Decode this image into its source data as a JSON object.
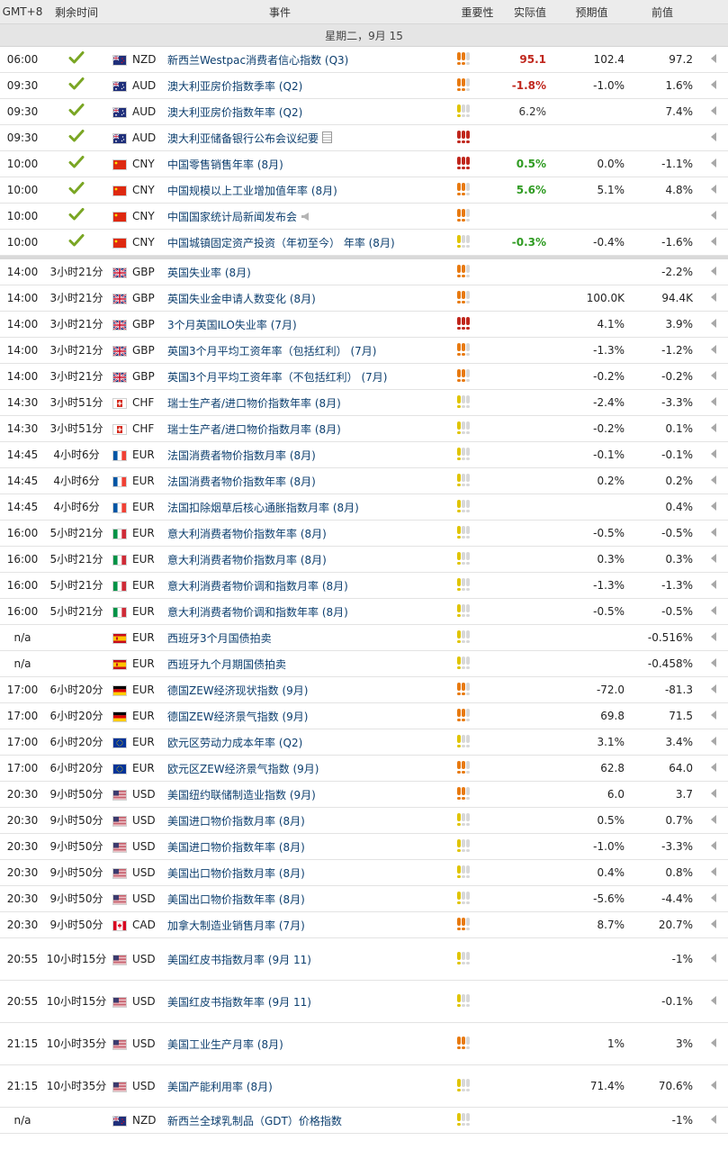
{
  "header": {
    "timezone": "GMT+8",
    "remaining": "剩余时间",
    "event": "事件",
    "importance": "重要性",
    "actual": "实际值",
    "forecast": "预期值",
    "previous": "前值"
  },
  "date_label": "星期二，9月 15",
  "colors": {
    "low": "#e0c400",
    "med": "#e87a10",
    "high": "#c0271d",
    "off": "#d8d8d8",
    "check": "#7aa624"
  },
  "events": [
    {
      "time": "06:00",
      "remaining": "",
      "done": true,
      "flag": "nz",
      "currency": "NZD",
      "name": "新西兰Westpac消费者信心指数 (Q3)",
      "imp": 2,
      "actual": "95.1",
      "dir": "down",
      "forecast": "102.4",
      "previous": "97.2",
      "icon": ""
    },
    {
      "time": "09:30",
      "remaining": "",
      "done": true,
      "flag": "au",
      "currency": "AUD",
      "name": "澳大利亚房价指数季率 (Q2)",
      "imp": 2,
      "actual": "-1.8%",
      "dir": "down",
      "forecast": "-1.0%",
      "previous": "1.6%",
      "icon": ""
    },
    {
      "time": "09:30",
      "remaining": "",
      "done": true,
      "flag": "au",
      "currency": "AUD",
      "name": "澳大利亚房价指数年率 (Q2)",
      "imp": 1,
      "actual": "6.2%",
      "dir": "neutral",
      "forecast": "",
      "previous": "7.4%",
      "icon": ""
    },
    {
      "time": "09:30",
      "remaining": "",
      "done": true,
      "flag": "au",
      "currency": "AUD",
      "name": "澳大利亚储备银行公布会议纪要",
      "imp": 3,
      "actual": "",
      "dir": "neutral",
      "forecast": "",
      "previous": "",
      "icon": "doc-icon"
    },
    {
      "time": "10:00",
      "remaining": "",
      "done": true,
      "flag": "cn",
      "currency": "CNY",
      "name": "中国零售销售年率 (8月)",
      "imp": 3,
      "actual": "0.5%",
      "dir": "up",
      "forecast": "0.0%",
      "previous": "-1.1%",
      "icon": ""
    },
    {
      "time": "10:00",
      "remaining": "",
      "done": true,
      "flag": "cn",
      "currency": "CNY",
      "name": "中国规模以上工业增加值年率 (8月)",
      "imp": 2,
      "actual": "5.6%",
      "dir": "up",
      "forecast": "5.1%",
      "previous": "4.8%",
      "icon": ""
    },
    {
      "time": "10:00",
      "remaining": "",
      "done": true,
      "flag": "cn",
      "currency": "CNY",
      "name": "中国国家统计局新闻发布会",
      "imp": 2,
      "actual": "",
      "dir": "neutral",
      "forecast": "",
      "previous": "",
      "icon": "speaker-icon"
    },
    {
      "time": "10:00",
      "remaining": "",
      "done": true,
      "flag": "cn",
      "currency": "CNY",
      "name": "中国城镇固定资产投资（年初至今） 年率 (8月)",
      "imp": 1,
      "actual": "-0.3%",
      "dir": "up",
      "forecast": "-0.4%",
      "previous": "-1.6%",
      "icon": ""
    },
    {
      "separator": true
    },
    {
      "time": "14:00",
      "remaining": "3小时21分",
      "done": false,
      "flag": "gb",
      "currency": "GBP",
      "name": "英国失业率 (8月)",
      "imp": 2,
      "actual": "",
      "dir": "neutral",
      "forecast": "",
      "previous": "-2.2%",
      "icon": ""
    },
    {
      "time": "14:00",
      "remaining": "3小时21分",
      "done": false,
      "flag": "gb",
      "currency": "GBP",
      "name": "英国失业金申请人数变化 (8月)",
      "imp": 2,
      "actual": "",
      "dir": "neutral",
      "forecast": "100.0K",
      "previous": "94.4K",
      "icon": ""
    },
    {
      "time": "14:00",
      "remaining": "3小时21分",
      "done": false,
      "flag": "gb",
      "currency": "GBP",
      "name": "3个月英国ILO失业率 (7月)",
      "imp": 3,
      "actual": "",
      "dir": "neutral",
      "forecast": "4.1%",
      "previous": "3.9%",
      "icon": ""
    },
    {
      "time": "14:00",
      "remaining": "3小时21分",
      "done": false,
      "flag": "gb",
      "currency": "GBP",
      "name": "英国3个月平均工资年率（包括红利） (7月)",
      "imp": 2,
      "actual": "",
      "dir": "neutral",
      "forecast": "-1.3%",
      "previous": "-1.2%",
      "icon": ""
    },
    {
      "time": "14:00",
      "remaining": "3小时21分",
      "done": false,
      "flag": "gb",
      "currency": "GBP",
      "name": "英国3个月平均工资年率（不包括红利） (7月)",
      "imp": 2,
      "actual": "",
      "dir": "neutral",
      "forecast": "-0.2%",
      "previous": "-0.2%",
      "icon": ""
    },
    {
      "time": "14:30",
      "remaining": "3小时51分",
      "done": false,
      "flag": "ch",
      "currency": "CHF",
      "name": "瑞士生产者/进口物价指数年率 (8月)",
      "imp": 1,
      "actual": "",
      "dir": "neutral",
      "forecast": "-2.4%",
      "previous": "-3.3%",
      "icon": ""
    },
    {
      "time": "14:30",
      "remaining": "3小时51分",
      "done": false,
      "flag": "ch",
      "currency": "CHF",
      "name": "瑞士生产者/进口物价指数月率 (8月)",
      "imp": 1,
      "actual": "",
      "dir": "neutral",
      "forecast": "-0.2%",
      "previous": "0.1%",
      "icon": ""
    },
    {
      "time": "14:45",
      "remaining": "4小时6分",
      "done": false,
      "flag": "fr",
      "currency": "EUR",
      "name": "法国消费者物价指数月率 (8月)",
      "imp": 1,
      "actual": "",
      "dir": "neutral",
      "forecast": "-0.1%",
      "previous": "-0.1%",
      "icon": ""
    },
    {
      "time": "14:45",
      "remaining": "4小时6分",
      "done": false,
      "flag": "fr",
      "currency": "EUR",
      "name": "法国消费者物价指数年率 (8月)",
      "imp": 1,
      "actual": "",
      "dir": "neutral",
      "forecast": "0.2%",
      "previous": "0.2%",
      "icon": ""
    },
    {
      "time": "14:45",
      "remaining": "4小时6分",
      "done": false,
      "flag": "fr",
      "currency": "EUR",
      "name": "法国扣除烟草后核心通胀指数月率 (8月)",
      "imp": 1,
      "actual": "",
      "dir": "neutral",
      "forecast": "",
      "previous": "0.4%",
      "icon": ""
    },
    {
      "time": "16:00",
      "remaining": "5小时21分",
      "done": false,
      "flag": "it",
      "currency": "EUR",
      "name": "意大利消费者物价指数年率 (8月)",
      "imp": 1,
      "actual": "",
      "dir": "neutral",
      "forecast": "-0.5%",
      "previous": "-0.5%",
      "icon": ""
    },
    {
      "time": "16:00",
      "remaining": "5小时21分",
      "done": false,
      "flag": "it",
      "currency": "EUR",
      "name": "意大利消费者物价指数月率 (8月)",
      "imp": 1,
      "actual": "",
      "dir": "neutral",
      "forecast": "0.3%",
      "previous": "0.3%",
      "icon": ""
    },
    {
      "time": "16:00",
      "remaining": "5小时21分",
      "done": false,
      "flag": "it",
      "currency": "EUR",
      "name": "意大利消费者物价调和指数月率 (8月)",
      "imp": 1,
      "actual": "",
      "dir": "neutral",
      "forecast": "-1.3%",
      "previous": "-1.3%",
      "icon": ""
    },
    {
      "time": "16:00",
      "remaining": "5小时21分",
      "done": false,
      "flag": "it",
      "currency": "EUR",
      "name": "意大利消费者物价调和指数年率 (8月)",
      "imp": 1,
      "actual": "",
      "dir": "neutral",
      "forecast": "-0.5%",
      "previous": "-0.5%",
      "icon": ""
    },
    {
      "time": "n/a",
      "remaining": "",
      "done": false,
      "flag": "es",
      "currency": "EUR",
      "name": "西班牙3个月国债拍卖",
      "imp": 1,
      "actual": "",
      "dir": "neutral",
      "forecast": "",
      "previous": "-0.516%",
      "icon": ""
    },
    {
      "time": "n/a",
      "remaining": "",
      "done": false,
      "flag": "es",
      "currency": "EUR",
      "name": "西班牙九个月期国债拍卖",
      "imp": 1,
      "actual": "",
      "dir": "neutral",
      "forecast": "",
      "previous": "-0.458%",
      "icon": ""
    },
    {
      "time": "17:00",
      "remaining": "6小时20分",
      "done": false,
      "flag": "de",
      "currency": "EUR",
      "name": "德国ZEW经济现状指数 (9月)",
      "imp": 2,
      "actual": "",
      "dir": "neutral",
      "forecast": "-72.0",
      "previous": "-81.3",
      "icon": ""
    },
    {
      "time": "17:00",
      "remaining": "6小时20分",
      "done": false,
      "flag": "de",
      "currency": "EUR",
      "name": "德国ZEW经济景气指数 (9月)",
      "imp": 2,
      "actual": "",
      "dir": "neutral",
      "forecast": "69.8",
      "previous": "71.5",
      "icon": ""
    },
    {
      "time": "17:00",
      "remaining": "6小时20分",
      "done": false,
      "flag": "eu",
      "currency": "EUR",
      "name": "欧元区劳动力成本年率 (Q2)",
      "imp": 1,
      "actual": "",
      "dir": "neutral",
      "forecast": "3.1%",
      "previous": "3.4%",
      "icon": ""
    },
    {
      "time": "17:00",
      "remaining": "6小时20分",
      "done": false,
      "flag": "eu",
      "currency": "EUR",
      "name": "欧元区ZEW经济景气指数 (9月)",
      "imp": 2,
      "actual": "",
      "dir": "neutral",
      "forecast": "62.8",
      "previous": "64.0",
      "icon": ""
    },
    {
      "time": "20:30",
      "remaining": "9小时50分",
      "done": false,
      "flag": "us",
      "currency": "USD",
      "name": "美国纽约联储制造业指数 (9月)",
      "imp": 2,
      "actual": "",
      "dir": "neutral",
      "forecast": "6.0",
      "previous": "3.7",
      "icon": ""
    },
    {
      "time": "20:30",
      "remaining": "9小时50分",
      "done": false,
      "flag": "us",
      "currency": "USD",
      "name": "美国进口物价指数月率 (8月)",
      "imp": 1,
      "actual": "",
      "dir": "neutral",
      "forecast": "0.5%",
      "previous": "0.7%",
      "icon": ""
    },
    {
      "time": "20:30",
      "remaining": "9小时50分",
      "done": false,
      "flag": "us",
      "currency": "USD",
      "name": "美国进口物价指数年率 (8月)",
      "imp": 1,
      "actual": "",
      "dir": "neutral",
      "forecast": "-1.0%",
      "previous": "-3.3%",
      "icon": ""
    },
    {
      "time": "20:30",
      "remaining": "9小时50分",
      "done": false,
      "flag": "us",
      "currency": "USD",
      "name": "美国出口物价指数月率 (8月)",
      "imp": 1,
      "actual": "",
      "dir": "neutral",
      "forecast": "0.4%",
      "previous": "0.8%",
      "icon": ""
    },
    {
      "time": "20:30",
      "remaining": "9小时50分",
      "done": false,
      "flag": "us",
      "currency": "USD",
      "name": "美国出口物价指数年率 (8月)",
      "imp": 1,
      "actual": "",
      "dir": "neutral",
      "forecast": "-5.6%",
      "previous": "-4.4%",
      "icon": ""
    },
    {
      "time": "20:30",
      "remaining": "9小时50分",
      "done": false,
      "flag": "ca",
      "currency": "CAD",
      "name": "加拿大制造业销售月率 (7月)",
      "imp": 2,
      "actual": "",
      "dir": "neutral",
      "forecast": "8.7%",
      "previous": "20.7%",
      "icon": ""
    },
    {
      "time": "20:55",
      "remaining": "10小时15分",
      "done": false,
      "flag": "us",
      "currency": "USD",
      "name": "美国红皮书指数月率 (9月 11)",
      "imp": 1,
      "actual": "",
      "dir": "neutral",
      "forecast": "",
      "previous": "-1%",
      "icon": "",
      "tall": true
    },
    {
      "time": "20:55",
      "remaining": "10小时15分",
      "done": false,
      "flag": "us",
      "currency": "USD",
      "name": "美国红皮书指数年率 (9月 11)",
      "imp": 1,
      "actual": "",
      "dir": "neutral",
      "forecast": "",
      "previous": "-0.1%",
      "icon": "",
      "tall": true
    },
    {
      "time": "21:15",
      "remaining": "10小时35分",
      "done": false,
      "flag": "us",
      "currency": "USD",
      "name": "美国工业生产月率 (8月)",
      "imp": 2,
      "actual": "",
      "dir": "neutral",
      "forecast": "1%",
      "previous": "3%",
      "icon": "",
      "tall": true
    },
    {
      "time": "21:15",
      "remaining": "10小时35分",
      "done": false,
      "flag": "us",
      "currency": "USD",
      "name": "美国产能利用率 (8月)",
      "imp": 1,
      "actual": "",
      "dir": "neutral",
      "forecast": "71.4%",
      "previous": "70.6%",
      "icon": "",
      "tall": true
    },
    {
      "time": "n/a",
      "remaining": "",
      "done": false,
      "flag": "nz",
      "currency": "NZD",
      "name": "新西兰全球乳制品（GDT）价格指数",
      "imp": 1,
      "actual": "",
      "dir": "neutral",
      "forecast": "",
      "previous": "-1%",
      "icon": ""
    }
  ]
}
